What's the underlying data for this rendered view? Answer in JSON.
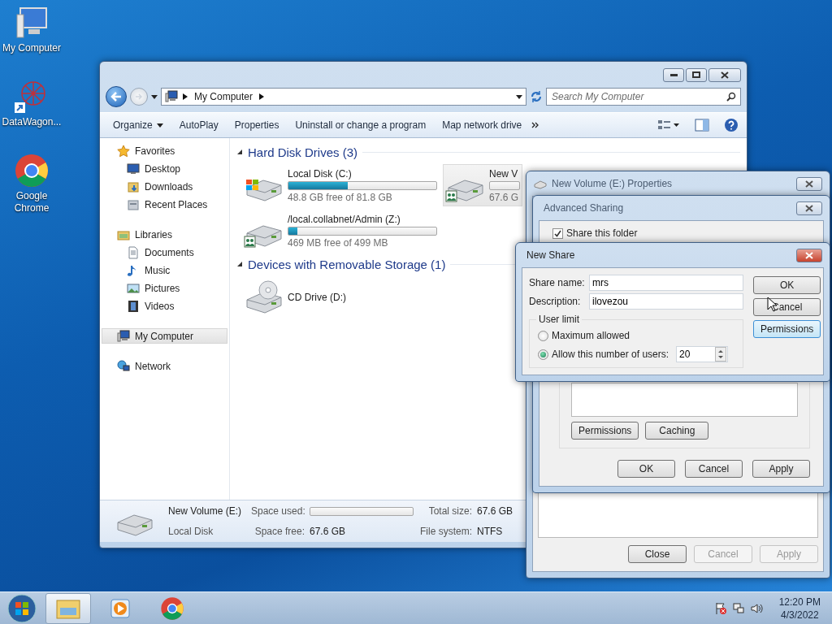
{
  "desktop_icons": [
    {
      "label": "My Computer",
      "kind": "computer"
    },
    {
      "label": "DataWagon...",
      "kind": "datawagon"
    },
    {
      "label": "Google Chrome",
      "kind": "chrome"
    }
  ],
  "explorer": {
    "address": [
      "My Computer"
    ],
    "search": {
      "placeholder": "Search My Computer"
    },
    "toolbar": [
      {
        "label": "Organize",
        "kind": "menu"
      },
      {
        "label": "AutoPlay",
        "kind": "plain"
      },
      {
        "label": "Properties",
        "kind": "plain"
      },
      {
        "label": "Uninstall or change a program",
        "kind": "plain"
      },
      {
        "label": "Map network drive",
        "kind": "plain"
      }
    ],
    "nav": [
      {
        "label": "Favorites",
        "selected": false,
        "children": [
          {
            "label": "Desktop",
            "selected": false
          },
          {
            "label": "Downloads",
            "selected": false
          },
          {
            "label": "Recent Places",
            "selected": false
          }
        ]
      },
      {
        "label": "Libraries",
        "selected": false,
        "children": [
          {
            "label": "Documents",
            "selected": false
          },
          {
            "label": "Music",
            "selected": false
          },
          {
            "label": "Pictures",
            "selected": false
          },
          {
            "label": "Videos",
            "selected": false
          }
        ]
      },
      {
        "label": "My Computer",
        "selected": true
      },
      {
        "label": "Network",
        "selected": false
      }
    ],
    "sections": [
      {
        "title": "Hard Disk Drives (3)",
        "expanded": true,
        "drives": [
          {
            "name": "Local Disk (C:)",
            "free": "48.8 GB free of 81.8 GB",
            "level": 0.4,
            "kind": "system",
            "selected": false
          },
          {
            "name": "New V",
            "free": "67.6 G",
            "level": 0,
            "kind": "shared",
            "selected": true
          },
          {
            "name": "/local.collabnet/Admin (Z:)",
            "free": "469 MB free of 499 MB",
            "level": 0.06,
            "kind": "shared",
            "selected": false
          }
        ]
      },
      {
        "title": "Devices with Removable Storage (1)",
        "expanded": true,
        "drives": [
          {
            "name": "CD Drive (D:)",
            "kind": "cd",
            "selected": false
          }
        ]
      }
    ],
    "details": {
      "name": "New Volume (E:)",
      "type": "Local Disk",
      "used_label": "Space used:",
      "level": 0,
      "free_label": "Space free:",
      "free": "67.6 GB",
      "total_label": "Total size:",
      "total": "67.6 GB",
      "fs_label": "File system:",
      "fs": "NTFS"
    }
  },
  "properties": {
    "title": "New Volume (E:) Properties",
    "buttons": [
      {
        "label": "Close",
        "disabled": false
      },
      {
        "label": "Cancel",
        "disabled": true
      },
      {
        "label": "Apply",
        "disabled": true
      }
    ]
  },
  "advanced_sharing": {
    "title": "Advanced Sharing",
    "share_folder": {
      "label": "Share this folder",
      "checked": true
    },
    "buttons": [
      "Permissions",
      "Caching"
    ],
    "footer": [
      "OK",
      "Cancel",
      "Apply"
    ]
  },
  "new_share": {
    "title": "New Share",
    "fields": [
      {
        "label": "Share name:",
        "value": "mrs"
      },
      {
        "label": "Description:",
        "value": "ilovezou"
      }
    ],
    "user_limit": {
      "title": "User limit",
      "options": [
        {
          "label": "Maximum allowed",
          "selected": false
        },
        {
          "label": "Allow this number of users:",
          "selected": true
        }
      ],
      "count": "20"
    },
    "buttons": [
      {
        "label": "OK",
        "focused": false
      },
      {
        "label": "Cancel",
        "focused": false
      },
      {
        "label": "Permissions",
        "focused": true
      }
    ]
  },
  "taskbar": {
    "apps": [
      {
        "kind": "explorer",
        "selected": true
      },
      {
        "kind": "media",
        "selected": false
      },
      {
        "kind": "chrome",
        "selected": false
      }
    ],
    "time": "12:20 PM",
    "date": "4/3/2022"
  }
}
